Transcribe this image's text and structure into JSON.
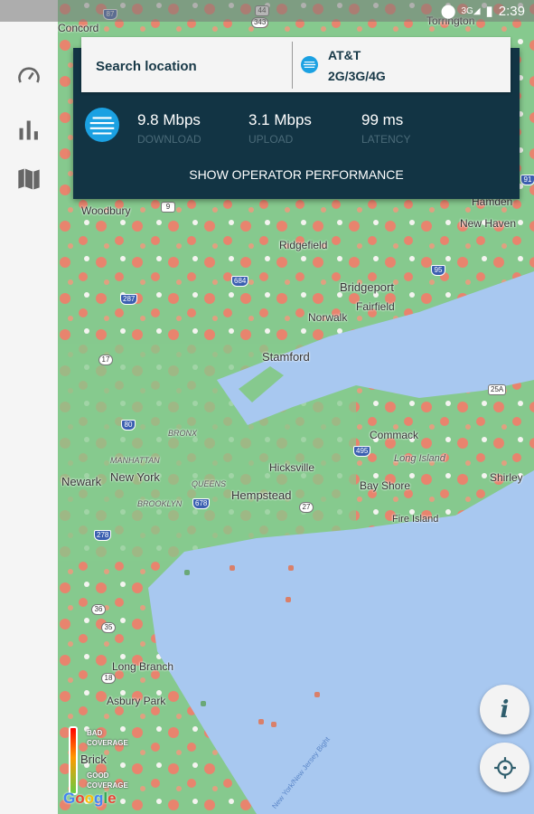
{
  "status_bar": {
    "network": "3G",
    "time": "2:39"
  },
  "sidebar": {
    "items": [
      {
        "name": "speed-test",
        "icon": "speedometer-icon"
      },
      {
        "name": "statistics",
        "icon": "bar-chart-icon"
      },
      {
        "name": "map",
        "icon": "map-icon"
      }
    ]
  },
  "search": {
    "placeholder": "Search location"
  },
  "operator": {
    "name": "AT&T",
    "technology": "2G/3G/4G",
    "brand_color": "#1ba1e2"
  },
  "metrics": {
    "download": {
      "value": "9.8 Mbps",
      "label": "DOWNLOAD"
    },
    "upload": {
      "value": "3.1 Mbps",
      "label": "UPLOAD"
    },
    "latency": {
      "value": "99 ms",
      "label": "LATENCY"
    }
  },
  "show_operator_label": "SHOW OPERATOR PERFORMANCE",
  "legend": {
    "bad": "BAD COVERAGE",
    "good": "GOOD COVERAGE",
    "bad_color": "#ff0000",
    "good_color": "#66cc44"
  },
  "map": {
    "attribution": "Google",
    "places": [
      "Torrington",
      "Woodbury",
      "Hamden",
      "New Haven",
      "Ridgefield",
      "Bridgeport",
      "Fairfield",
      "Norwalk",
      "Stamford",
      "Commack",
      "Long Island",
      "Shirley",
      "Newark",
      "New York",
      "Hicksville",
      "Hempstead",
      "Bay Shore",
      "Fire Island",
      "Long Branch",
      "Asbury Park",
      "Brick",
      "MANHATTAN",
      "BRONX",
      "QUEENS",
      "BROOKLYN",
      "New York/New Jersey Bight",
      "Concord"
    ],
    "routes": [
      "87",
      "44",
      "343",
      "9",
      "684",
      "95",
      "287",
      "17",
      "80",
      "25A",
      "495",
      "678",
      "278",
      "27",
      "36",
      "35",
      "18",
      "91"
    ]
  },
  "buttons": {
    "info": "i"
  }
}
